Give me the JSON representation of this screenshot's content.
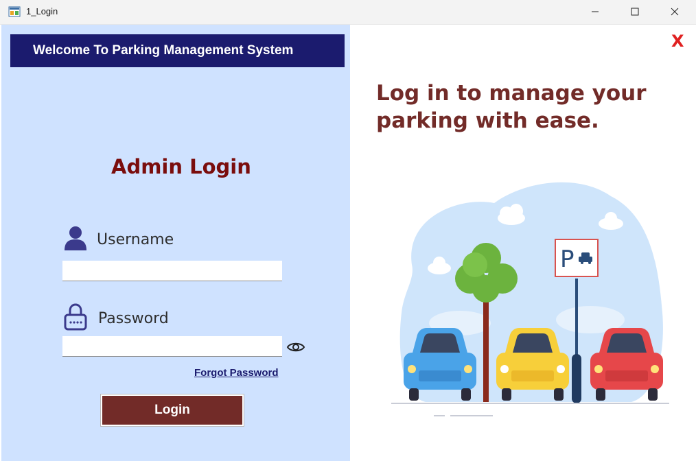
{
  "window": {
    "title": "1_Login",
    "icon": "app-window-icon",
    "controls": [
      "minimize-icon",
      "maximize-icon",
      "close-icon"
    ]
  },
  "banner": {
    "text": "Welcome To Parking Management System"
  },
  "login_form": {
    "heading": "Admin Login",
    "username": {
      "label": "Username",
      "value": "",
      "icon": "user-icon"
    },
    "password": {
      "label": "Password",
      "value": "",
      "icon": "lock-icon",
      "toggle_icon": "eye-icon"
    },
    "forgot_password": "Forgot Password",
    "login_button": "Login"
  },
  "right_panel": {
    "close_label": "X",
    "tagline": "Log in to manage your parking with ease.",
    "illustration": "parking-lot-illustration",
    "sign_letter": "P"
  },
  "colors": {
    "left_bg": "#cfe2ff",
    "banner_bg": "#1b1b6e",
    "heading": "#7a0d0d",
    "button_bg": "#722b28",
    "close_x": "#e02020"
  }
}
